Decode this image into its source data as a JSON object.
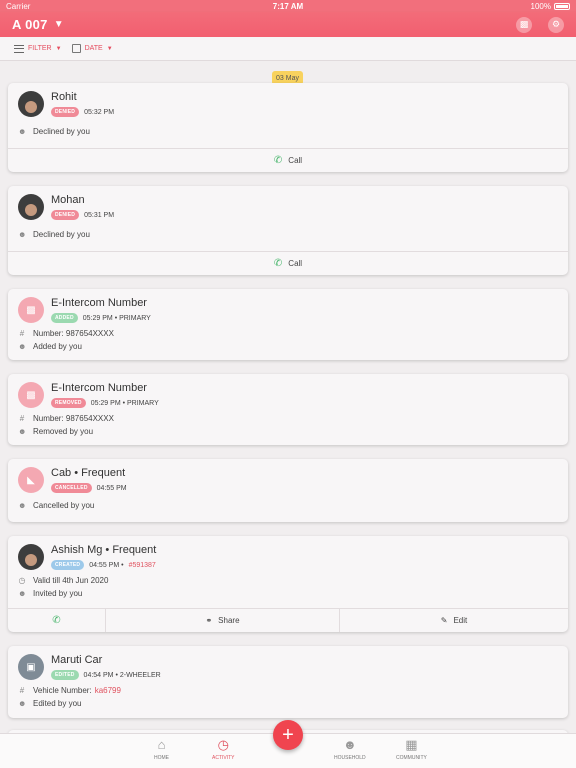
{
  "status_bar": {
    "carrier": "Carrier",
    "time": "7:17 AM",
    "battery": "100%"
  },
  "header": {
    "flat": "A 007",
    "icons": [
      "intercom-icon",
      "settings-icon"
    ]
  },
  "filter_bar": {
    "filter_label": "FILTER",
    "date_label": "DATE"
  },
  "date_chip": "03 May",
  "cards": [
    {
      "title": "Rohit",
      "badge": "DENIED",
      "time": "05:32 PM",
      "line1": "Declined by you",
      "action": "Call"
    },
    {
      "title": "Mohan",
      "badge": "DENIED",
      "time": "05:31 PM",
      "line1": "Declined by you",
      "action": "Call"
    },
    {
      "title": "E-Intercom Number",
      "badge": "ADDED",
      "time": "05:29 PM • PRIMARY",
      "line1": "Number: 987654XXXX",
      "line2": "Added by you"
    },
    {
      "title": "E-Intercom Number",
      "badge": "REMOVED",
      "time": "05:29 PM • PRIMARY",
      "line1": "Number: 987654XXXX",
      "line2": "Removed by you"
    },
    {
      "title": "Cab • Frequent",
      "badge": "CANCELLED",
      "time": "04:55 PM",
      "line1": "Cancelled by you"
    },
    {
      "title": "Ashish Mg • Frequent",
      "badge": "CREATED",
      "time": "04:55 PM •",
      "code": "#591387",
      "line1": "Valid till 4th Jun 2020",
      "line2": "Invited by you",
      "share": "Share",
      "edit": "Edit"
    },
    {
      "title": "Maruti Car",
      "badge": "EDITED",
      "time": "04:54 PM • 2-WHEELER",
      "line1_label": "Vehicle Number:",
      "line1_value": "ka6799",
      "line2": "Edited by you"
    }
  ],
  "bottom_nav": {
    "home": "HOME",
    "activity": "ACTIVITY",
    "household": "HOUSEHOLD",
    "community": "COMMUNITY",
    "fab": "+"
  },
  "colors": {
    "brand": "#f26f7c",
    "accent": "#e0525f",
    "call_green": "#47b56b",
    "date_chip": "#f8d25e"
  }
}
